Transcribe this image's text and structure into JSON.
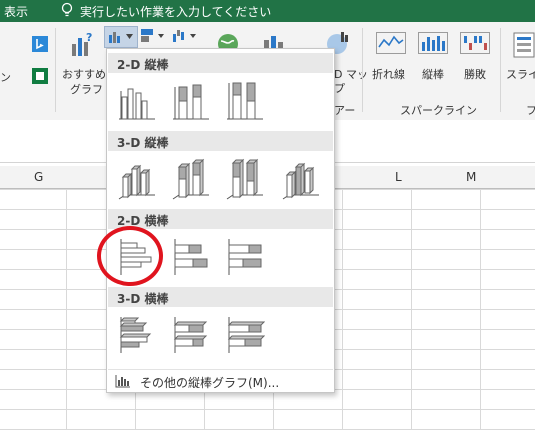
{
  "titlebar": {
    "tab": "表示",
    "tell_me": "実行したい作業を入力してください"
  },
  "ribbon": {
    "left_partial": "ン",
    "recommended_line1": "おすすめ",
    "recommended_line2": "グラフ",
    "map_line1": "D マッ",
    "map_line2": "プ",
    "tours_group_partial": "アー",
    "spark_line": "折れ線",
    "spark_column": "縦棒",
    "spark_winloss": "勝敗",
    "sparklines_group": "スパークライン",
    "slicer_partial": "スライ",
    "right_partial": "フ"
  },
  "columns": {
    "g": "G",
    "l": "L",
    "m": "M"
  },
  "dropdown": {
    "sections": [
      {
        "title": "2-D 縦棒"
      },
      {
        "title": "3-D 縦棒"
      },
      {
        "title": "2-D 横棒"
      },
      {
        "title": "3-D 横棒"
      }
    ],
    "more": "その他の縦棒グラフ(M)..."
  },
  "colors": {
    "excel_green": "#217346",
    "highlight": "#e0141e"
  }
}
